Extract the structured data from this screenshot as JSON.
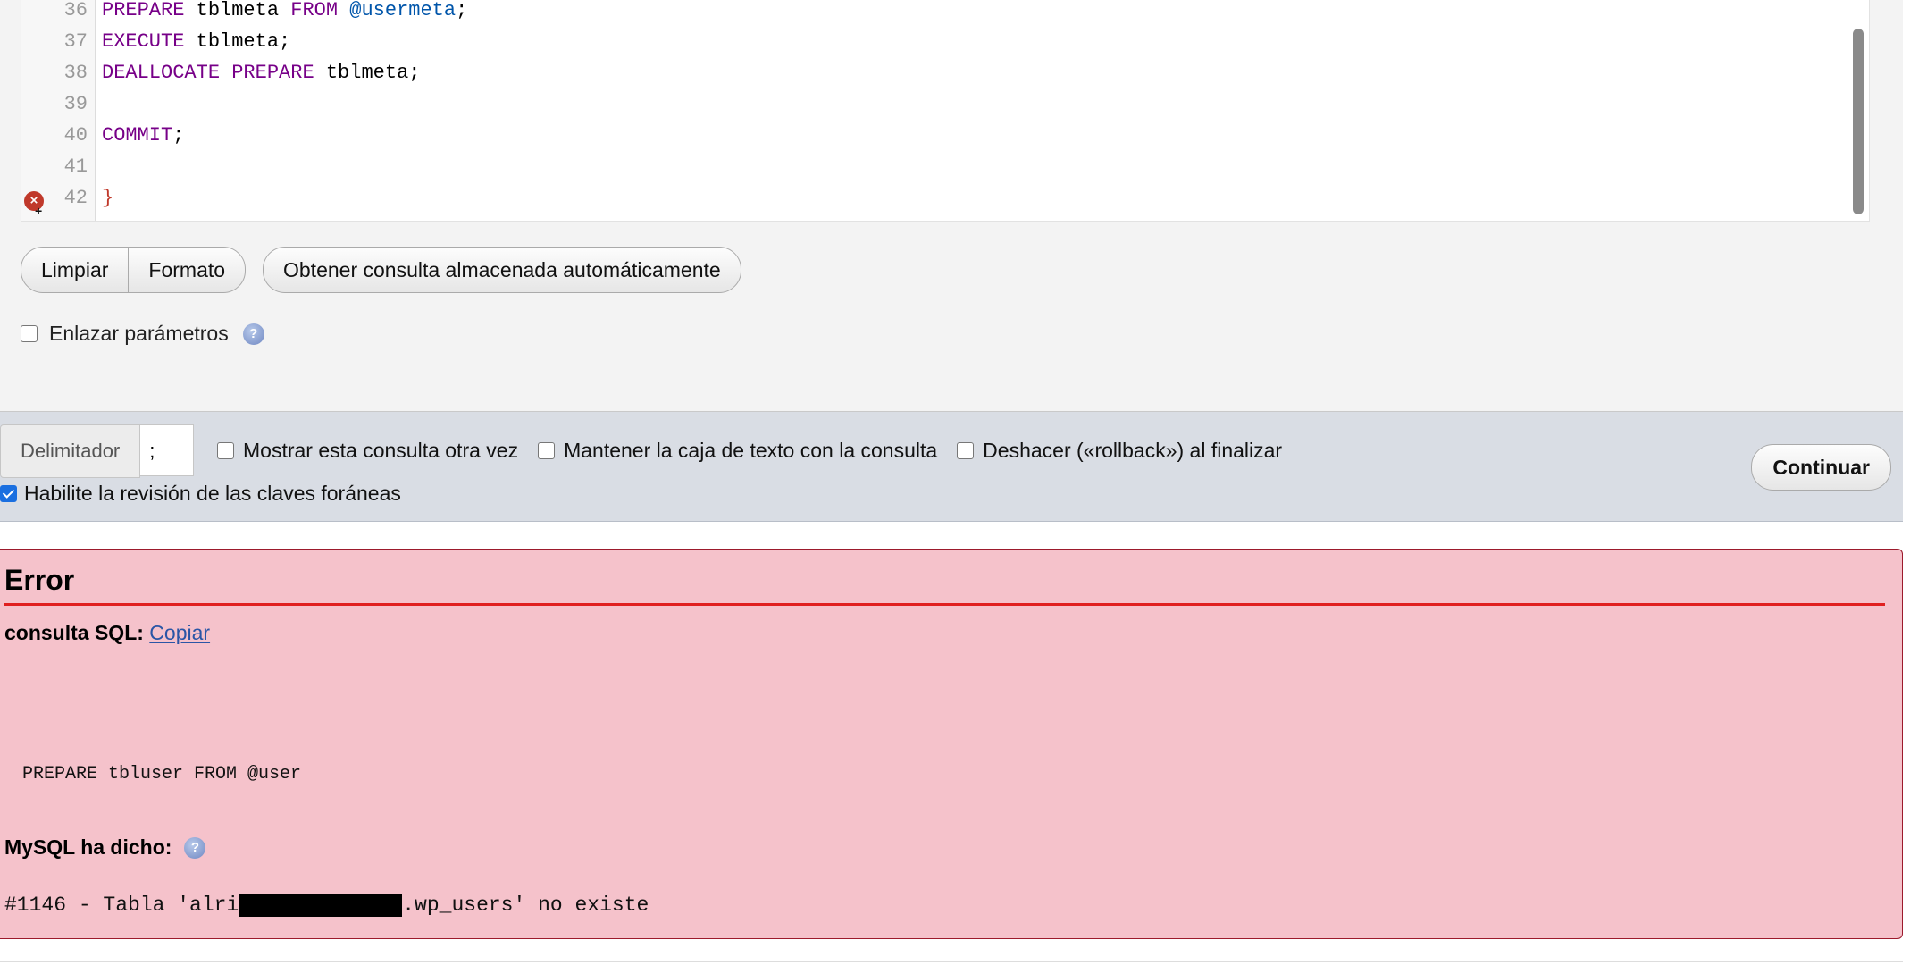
{
  "editor": {
    "lines": [
      {
        "n": "36",
        "parts": [
          {
            "t": "PREPARE",
            "c": "kw"
          },
          {
            "t": " tblmeta "
          },
          {
            "t": "FROM",
            "c": "kw"
          },
          {
            "t": " "
          },
          {
            "t": "@usermeta",
            "c": "var"
          },
          {
            "t": ";"
          }
        ]
      },
      {
        "n": "37",
        "parts": [
          {
            "t": "EXECUTE",
            "c": "kw"
          },
          {
            "t": " tblmeta;"
          }
        ]
      },
      {
        "n": "38",
        "parts": [
          {
            "t": "DEALLOCATE",
            "c": "kw"
          },
          {
            "t": " "
          },
          {
            "t": "PREPARE",
            "c": "kw"
          },
          {
            "t": " tblmeta;"
          }
        ]
      },
      {
        "n": "39",
        "parts": []
      },
      {
        "n": "40",
        "parts": [
          {
            "t": "COMMIT",
            "c": "kw"
          },
          {
            "t": ";"
          }
        ]
      },
      {
        "n": "41",
        "parts": []
      },
      {
        "n": "42",
        "parts": [
          {
            "t": "}",
            "c": "err"
          }
        ]
      }
    ]
  },
  "toolbar": {
    "clear_label": "Limpiar",
    "format_label": "Formato",
    "autostored_label": "Obtener consulta almacenada automáticamente"
  },
  "bind_params": {
    "label": "Enlazar parámetros",
    "checked": false
  },
  "options": {
    "delimiter_label": "Delimitador",
    "delimiter_value": ";",
    "show_query_again": {
      "label": "Mostrar esta consulta otra vez",
      "checked": false
    },
    "retain_box": {
      "label": "Mantener la caja de texto con la consulta",
      "checked": false
    },
    "rollback": {
      "label": "Deshacer («rollback») al finalizar",
      "checked": false
    },
    "fk_checks": {
      "label": "Habilite la revisión de las claves foráneas",
      "checked": true
    },
    "go_label": "Continuar"
  },
  "error": {
    "title": "Error",
    "sql_query_label": "consulta SQL:",
    "copy_label": "Copiar",
    "sql_code": "PREPARE tbluser FROM @user",
    "mysql_said": "MySQL ha dicho:",
    "message_prefix": "#1146 - Tabla 'alri",
    "message_suffix": ".wp_users' no existe"
  },
  "colors": {
    "keyword": "#770088",
    "variable": "#0055aa",
    "error_bg": "#f5c2cb",
    "error_rule": "#e02020",
    "link": "#2a55a6"
  },
  "icons": [
    "error-marker-icon",
    "help-icon",
    "checkbox-icon"
  ]
}
